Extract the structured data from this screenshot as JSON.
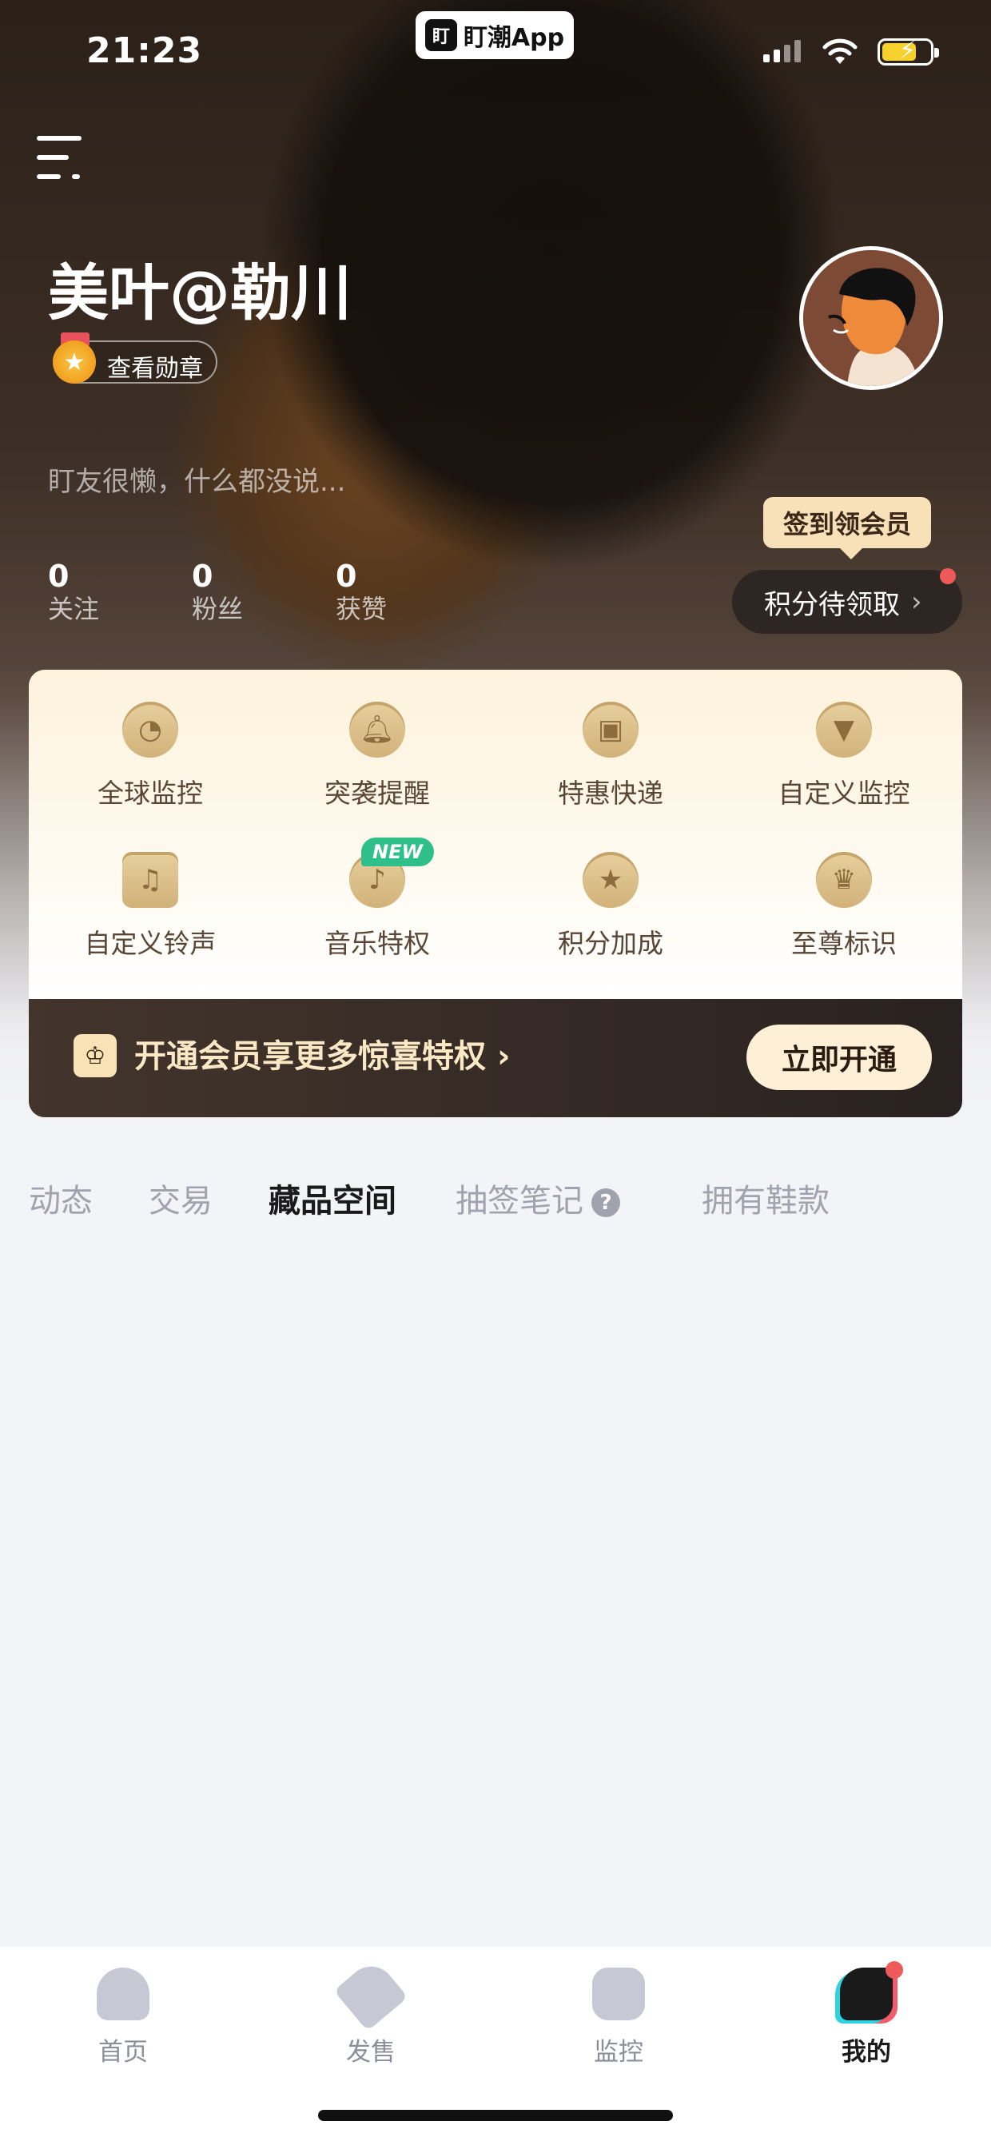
{
  "status_bar": {
    "time": "21:23",
    "app_badge": "盯潮App",
    "app_logo": "盯"
  },
  "profile": {
    "username": "美叶@勒川",
    "medal_label": "查看勋章",
    "bio": "盯友很懒，什么都没说...",
    "stats": [
      {
        "value": "0",
        "label": "关注"
      },
      {
        "value": "0",
        "label": "粉丝"
      },
      {
        "value": "0",
        "label": "获赞"
      }
    ],
    "tooltip": "签到领会员",
    "points_button": "积分待领取"
  },
  "features": [
    {
      "label": "全球监控",
      "icon": "gauge-icon"
    },
    {
      "label": "突袭提醒",
      "icon": "bell-icon"
    },
    {
      "label": "特惠快递",
      "icon": "package-icon"
    },
    {
      "label": "自定义监控",
      "icon": "filter-icon"
    },
    {
      "label": "自定义铃声",
      "icon": "music-note-icon"
    },
    {
      "label": "音乐特权",
      "icon": "music-disc-icon"
    },
    {
      "label": "积分加成",
      "icon": "star-icon"
    },
    {
      "label": "至尊标识",
      "icon": "crown-icon"
    }
  ],
  "new_badge": "NEW",
  "vip": {
    "text": "开通会员享更多惊喜特权",
    "chevron": "›",
    "button": "立即开通"
  },
  "tabs": [
    {
      "label": "动态",
      "active": false
    },
    {
      "label": "交易",
      "active": false
    },
    {
      "label": "藏品空间",
      "active": true
    },
    {
      "label": "抽签笔记",
      "active": false
    },
    {
      "label": "拥有鞋款",
      "active": false
    }
  ],
  "help_glyph": "?",
  "bottom_nav": [
    {
      "label": "首页",
      "icon": "home-icon",
      "active": false
    },
    {
      "label": "发售",
      "icon": "tag-icon",
      "active": false
    },
    {
      "label": "监控",
      "icon": "monitor-gauge-icon",
      "active": false
    },
    {
      "label": "我的",
      "icon": "sneaker-icon",
      "active": true
    }
  ],
  "colors": {
    "accent_gold": "#f8e0b8",
    "notify_red": "#ee5a5a",
    "new_green": "#2fbf8b",
    "vip_dark": "#2a2220"
  }
}
